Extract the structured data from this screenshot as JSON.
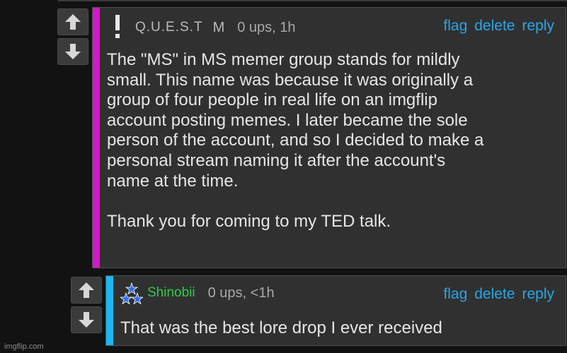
{
  "comments": [
    {
      "username": "Q.U.E.S.T",
      "flair": "M",
      "meta": "0 ups, 1h",
      "actions": [
        "flag",
        "delete",
        "reply"
      ],
      "accent_color": "#d418c8",
      "body": "The \"MS\" in MS memer group stands for mildly\nsmall. This name was because it was originally a\ngroup of four people in real life on an imgflip\naccount posting memes. I later became the sole\nperson of the account, and so I decided to make a\npersonal stream naming it after the account's\nname at the time.\n\nThank you for coming to my TED talk.",
      "icon": "exclamation-icon"
    },
    {
      "username": "Shinobii",
      "meta": "0 ups, <1h",
      "actions": [
        "flag",
        "delete",
        "reply"
      ],
      "accent_color": "#1ab8f0",
      "username_color": "#33c94a",
      "body": "That was the best lore drop I ever received",
      "icon": "triple-star-badge-icon"
    }
  ],
  "vote_icons": [
    "upvote-arrow-icon",
    "downvote-arrow-icon"
  ],
  "watermark": "imgflip.com"
}
